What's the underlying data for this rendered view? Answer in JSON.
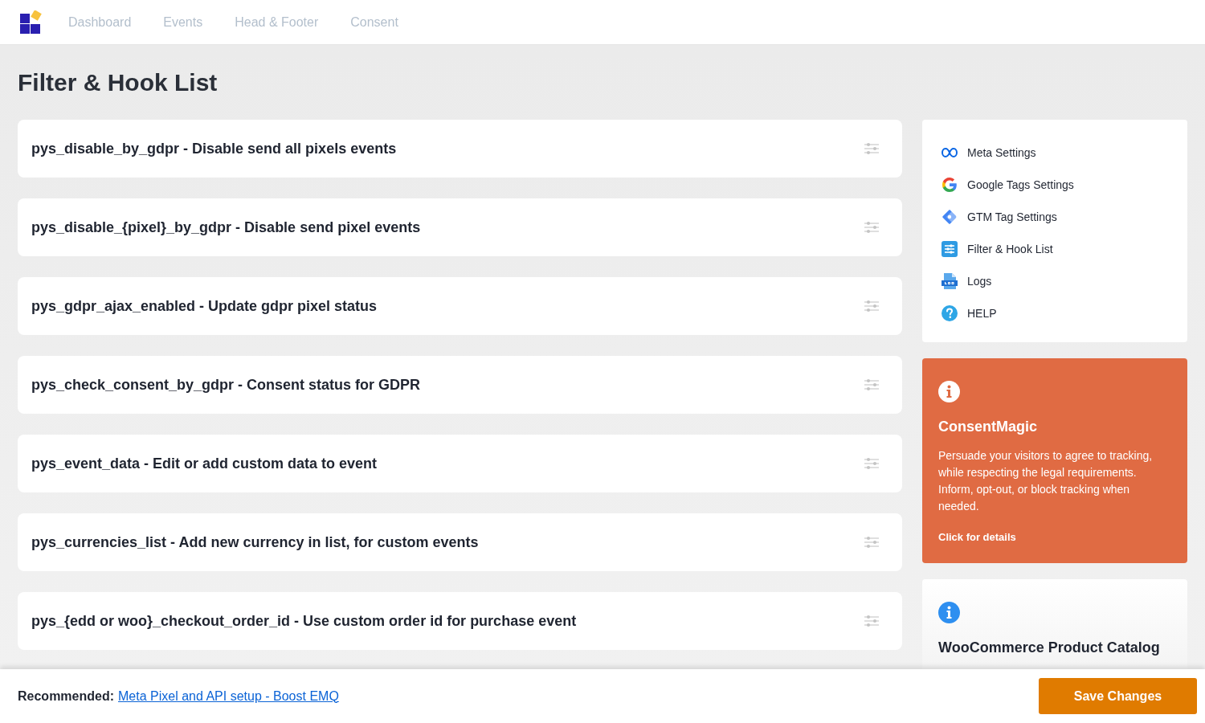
{
  "header": {
    "nav": [
      "Dashboard",
      "Events",
      "Head & Footer",
      "Consent"
    ]
  },
  "page_title": "Filter & Hook List",
  "hooks": [
    {
      "title": "pys_disable_by_gdpr - Disable send all pixels events"
    },
    {
      "title": "pys_disable_{pixel}_by_gdpr - Disable send pixel events"
    },
    {
      "title": "pys_gdpr_ajax_enabled - Update gdpr pixel status"
    },
    {
      "title": "pys_check_consent_by_gdpr - Consent status for GDPR"
    },
    {
      "title": "pys_event_data - Edit or add custom data to event"
    },
    {
      "title": "pys_currencies_list - Add new currency in list, for custom events"
    },
    {
      "title": "pys_{edd or woo}_checkout_order_id - Use custom order id for purchase event"
    }
  ],
  "sidebar": {
    "menu": [
      {
        "kind": "meta",
        "label": "Meta Settings"
      },
      {
        "kind": "google",
        "label": "Google Tags Settings"
      },
      {
        "kind": "gtm",
        "label": "GTM Tag Settings"
      },
      {
        "kind": "filter",
        "label": "Filter & Hook List"
      },
      {
        "kind": "logs",
        "label": "Logs"
      },
      {
        "kind": "help",
        "label": "HELP"
      }
    ],
    "promo_cards": [
      {
        "kind": "accent",
        "title": "ConsentMagic",
        "text": "Persuade your visitors to agree to tracking, while respecting the legal requirements. Inform, opt-out, or block tracking when needed.",
        "link": "Click for details"
      },
      {
        "kind": "plain",
        "title": "WooCommerce Product Catalog"
      }
    ]
  },
  "footer": {
    "label": "Recommended:",
    "link": "Meta Pixel and API setup - Boost EMQ",
    "save_button": "Save Changes"
  }
}
